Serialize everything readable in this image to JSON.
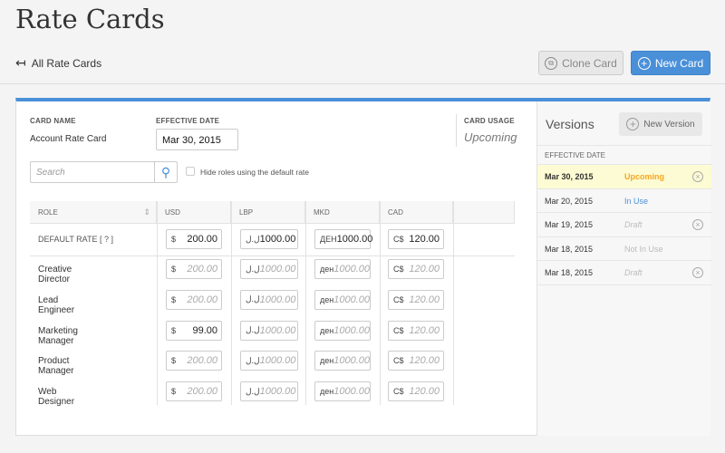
{
  "page": {
    "title": "Rate Cards",
    "back_label": "All Rate Cards",
    "clone_label": "Clone Card",
    "new_card_label": "New Card"
  },
  "card": {
    "name_label": "CARD NAME",
    "name": "Account Rate Card",
    "date_label": "EFFECTIVE DATE",
    "date": "Mar 30, 2015",
    "usage_label": "CARD USAGE",
    "usage": "Upcoming"
  },
  "filter": {
    "search_placeholder": "Search",
    "hide_label": "Hide roles using the default rate",
    "hide_checked": false
  },
  "table": {
    "columns": [
      "ROLE",
      "USD",
      "LBP",
      "MKD",
      "CAD"
    ],
    "symbols": [
      "$",
      "ل.ل",
      "ден",
      "C$"
    ],
    "default_row": {
      "label": "DEFAULT RATE  [ ? ]",
      "symbols": [
        "$",
        "ل.ل",
        "ДЕН",
        "C$"
      ],
      "values": [
        "200.00",
        "1000.00",
        "1000.00",
        "120.00"
      ]
    },
    "rows": [
      {
        "role": "Creative Director",
        "values": [
          "200.00",
          "1000.00",
          "1000.00",
          "120.00"
        ],
        "overrides": [
          false,
          false,
          false,
          false
        ]
      },
      {
        "role": "Lead Engineer",
        "values": [
          "200.00",
          "1000.00",
          "1000.00",
          "120.00"
        ],
        "overrides": [
          false,
          false,
          false,
          false
        ]
      },
      {
        "role": "Marketing Manager",
        "values": [
          "99.00",
          "1000.00",
          "1000.00",
          "120.00"
        ],
        "overrides": [
          true,
          false,
          false,
          false
        ]
      },
      {
        "role": "Product Manager",
        "values": [
          "200.00",
          "1000.00",
          "1000.00",
          "120.00"
        ],
        "overrides": [
          false,
          false,
          false,
          false
        ]
      },
      {
        "role": "Web Designer",
        "values": [
          "200.00",
          "1000.00",
          "1000.00",
          "120.00"
        ],
        "overrides": [
          false,
          false,
          false,
          false
        ]
      }
    ]
  },
  "versions": {
    "title": "Versions",
    "new_label": "New Version",
    "col_label": "EFFECTIVE DATE",
    "items": [
      {
        "date": "Mar 30, 2015",
        "status": "Upcoming",
        "color": "#f5a623",
        "selected": true,
        "deletable": true
      },
      {
        "date": "Mar 20, 2015",
        "status": "In Use",
        "color": "#4a90d9",
        "selected": false,
        "deletable": false
      },
      {
        "date": "Mar 19, 2015",
        "status": "Draft",
        "color": "#bbbbbb",
        "selected": false,
        "deletable": true
      },
      {
        "date": "Mar 18, 2015",
        "status": "Not In Use",
        "color": "#bbbbbb",
        "selected": false,
        "deletable": false
      },
      {
        "date": "Mar 18, 2015",
        "status": "Draft",
        "color": "#bbbbbb",
        "selected": false,
        "deletable": true
      }
    ]
  },
  "colors": {
    "accent": "#4a90d9",
    "upcoming": "#f5a623",
    "selected_row": "#fdfbd3"
  }
}
